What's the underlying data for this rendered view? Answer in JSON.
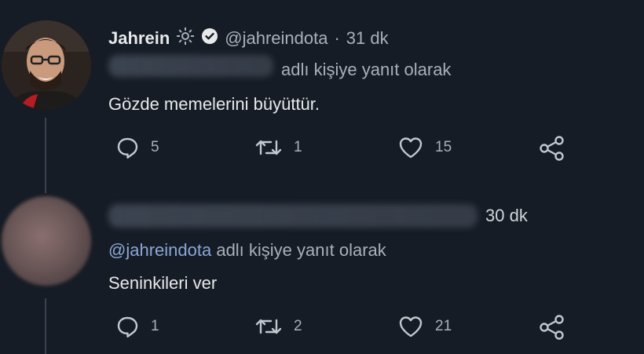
{
  "tweets": [
    {
      "author_name": "Jahrein",
      "handle": "@jahreindota",
      "time": "31 dk",
      "reply_to_suffix": "adlı kişiye yanıt olarak",
      "text": "Gözde memelerini büyüttür.",
      "replies": "5",
      "retweets": "1",
      "likes": "15"
    },
    {
      "time": "30 dk",
      "reply_to_handle": "@jahreindota",
      "reply_to_suffix": "adlı kişiye yanıt olarak",
      "text": "Seninkileri ver",
      "replies": "1",
      "retweets": "2",
      "likes": "21"
    }
  ],
  "icons": {
    "reply": "reply-icon",
    "retweet": "retweet-icon",
    "like": "heart-icon",
    "share": "share-icon",
    "gear": "gear-icon",
    "verified": "verified-badge-icon"
  }
}
